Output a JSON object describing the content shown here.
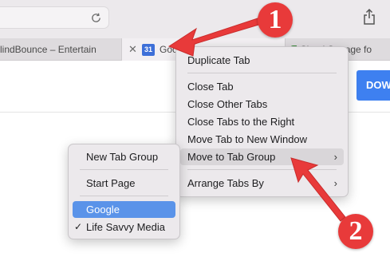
{
  "tabs": [
    {
      "title": "lindBounce – Entertain"
    },
    {
      "close_glyph": "✕",
      "icon_text": "31",
      "title": "Goo"
    },
    {
      "title": "Cloud Storage fo"
    }
  ],
  "page": {
    "download_label": "DOW"
  },
  "context_menu": {
    "items": [
      {
        "label": "Duplicate Tab"
      },
      {
        "label": "Close Tab"
      },
      {
        "label": "Close Other Tabs"
      },
      {
        "label": "Close Tabs to the Right"
      },
      {
        "label": "Move Tab to New Window"
      },
      {
        "label": "Move to Tab Group",
        "has_submenu": true
      },
      {
        "label": "Arrange Tabs By",
        "has_submenu": true
      }
    ],
    "chevron": "›"
  },
  "submenu": {
    "items": [
      {
        "label": "New Tab Group"
      },
      {
        "label": "Start Page"
      },
      {
        "label": "Google",
        "selected": true
      },
      {
        "label": "Life Savvy Media",
        "checked": true
      }
    ],
    "check_glyph": "✓"
  },
  "callouts": [
    {
      "number": "1"
    },
    {
      "number": "2"
    }
  ],
  "colors": {
    "accent_blue": "#3e80f0",
    "selection_blue": "#5a93e9",
    "callout_red": "#e83a3a",
    "menu_bg": "#ece9ec"
  }
}
